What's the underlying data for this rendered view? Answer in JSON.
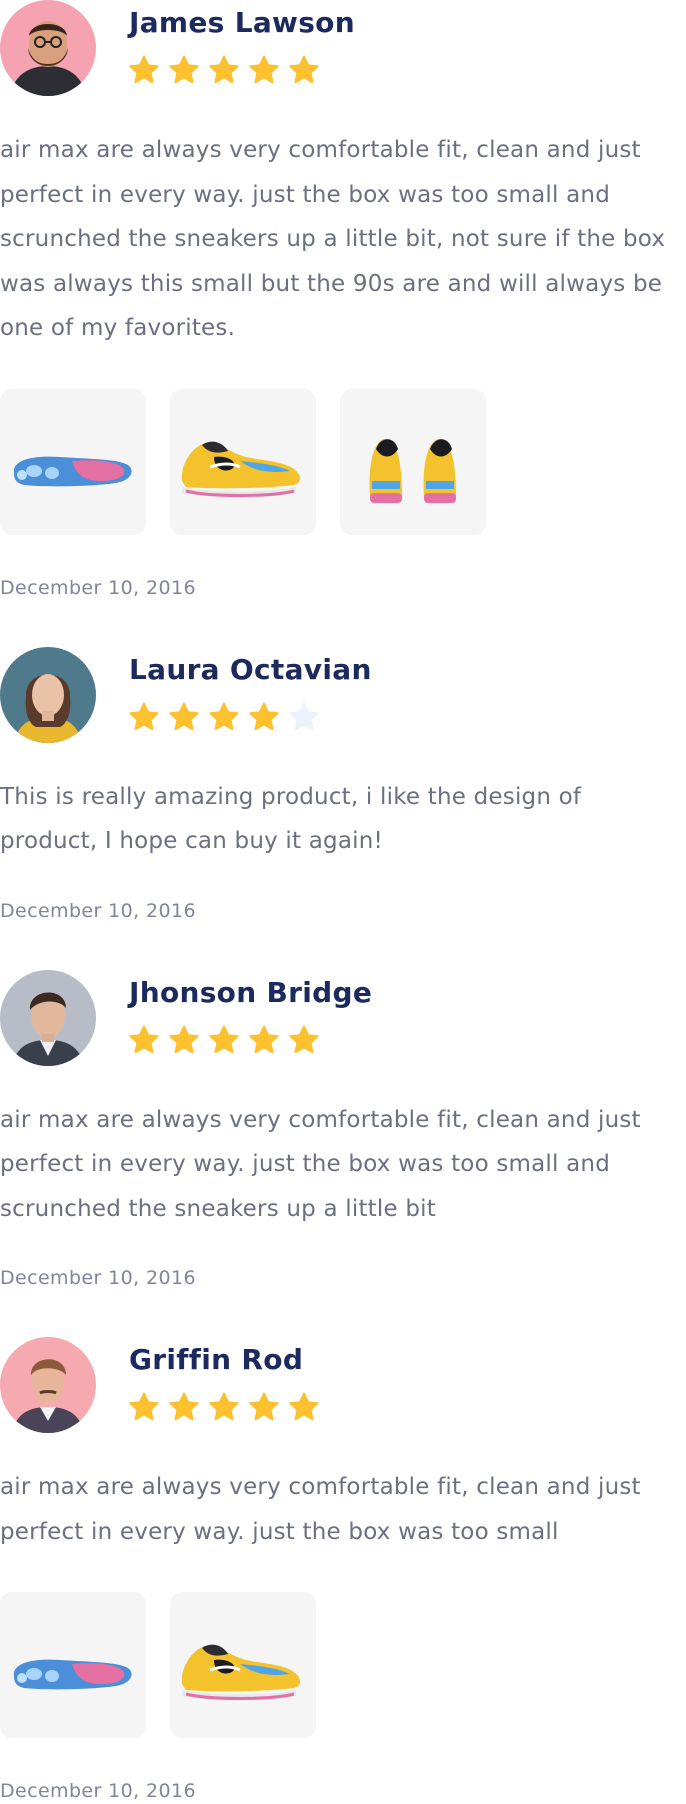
{
  "colors": {
    "name": "#1c2a5e",
    "body_text": "#6b7080",
    "date_text": "#80859a",
    "star_filled": "#fdc12f",
    "star_empty": "#edf1fb",
    "photo_bg": "#f5f5f6"
  },
  "reviews": [
    {
      "name": "James Lawson",
      "avatar": "avatar-james-lawson",
      "rating": 5,
      "max_rating": 5,
      "body": "air max are always very comfortable fit, clean and just perfect in every way. just the box was too small and scrunched the sneakers up a little bit, not sure if the box was always this small but the 90s are and will always be one of my favorites.",
      "photos": [
        "sneaker-sole-photo",
        "sneaker-side-photo",
        "sneaker-back-pair-photo"
      ],
      "date": "December 10, 2016"
    },
    {
      "name": "Laura Octavian",
      "avatar": "avatar-laura-octavian",
      "rating": 4,
      "max_rating": 5,
      "body": "This is really amazing product, i like the design of product, I hope can buy it again!",
      "photos": [],
      "date": "December 10, 2016"
    },
    {
      "name": "Jhonson Bridge",
      "avatar": "avatar-jhonson-bridge",
      "rating": 5,
      "max_rating": 5,
      "body": "air max are always very comfortable fit, clean and just perfect in every way. just the box was too small and scrunched the sneakers up a little bit",
      "photos": [],
      "date": "December 10, 2016"
    },
    {
      "name": "Griffin Rod",
      "avatar": "avatar-griffin-rod",
      "rating": 5,
      "max_rating": 5,
      "body": "air max are always very comfortable fit, clean and just perfect in every way. just the box was too small",
      "photos": [
        "sneaker-sole-photo",
        "sneaker-side-photo"
      ],
      "date": "December 10, 2016"
    }
  ]
}
